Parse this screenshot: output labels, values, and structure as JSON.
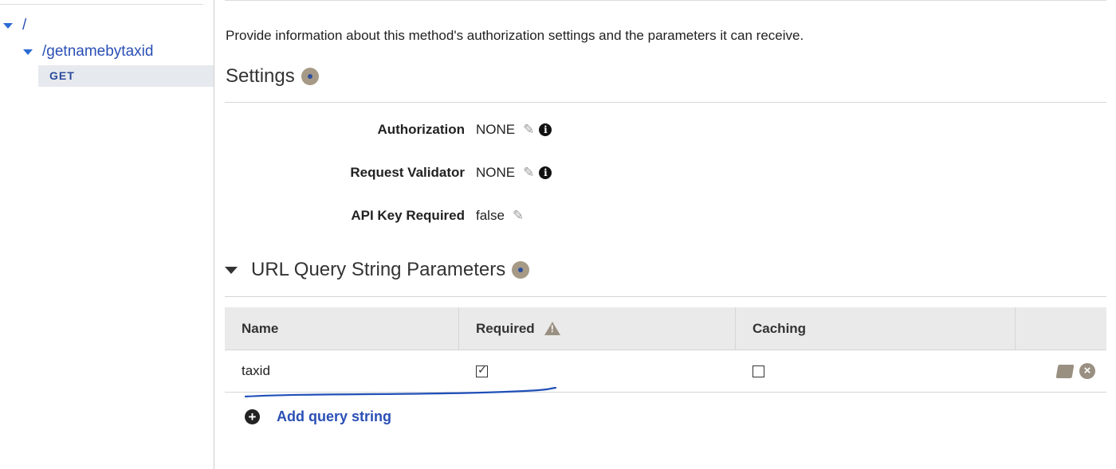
{
  "sidebar": {
    "root": "/",
    "resource": "/getnamebytaxid",
    "method": "GET"
  },
  "main": {
    "description": "Provide information about this method's authorization settings and the parameters it can receive.",
    "settings_title": "Settings",
    "settings": [
      {
        "label": "Authorization",
        "value": "NONE",
        "has_info": true
      },
      {
        "label": "Request Validator",
        "value": "NONE",
        "has_info": true
      },
      {
        "label": "API Key Required",
        "value": "false",
        "has_info": false
      }
    ],
    "query_section_title": "URL Query String Parameters",
    "table": {
      "headers": [
        "Name",
        "Required",
        "Caching",
        ""
      ],
      "rows": [
        {
          "name": "taxid",
          "required": true,
          "caching": false
        }
      ]
    },
    "add_label": "Add query string"
  },
  "colors": {
    "link": "#2a4fb5",
    "header_bg": "#eaeaea",
    "selected_bg": "#e6e9ee",
    "icon_gray": "#9a9082"
  }
}
